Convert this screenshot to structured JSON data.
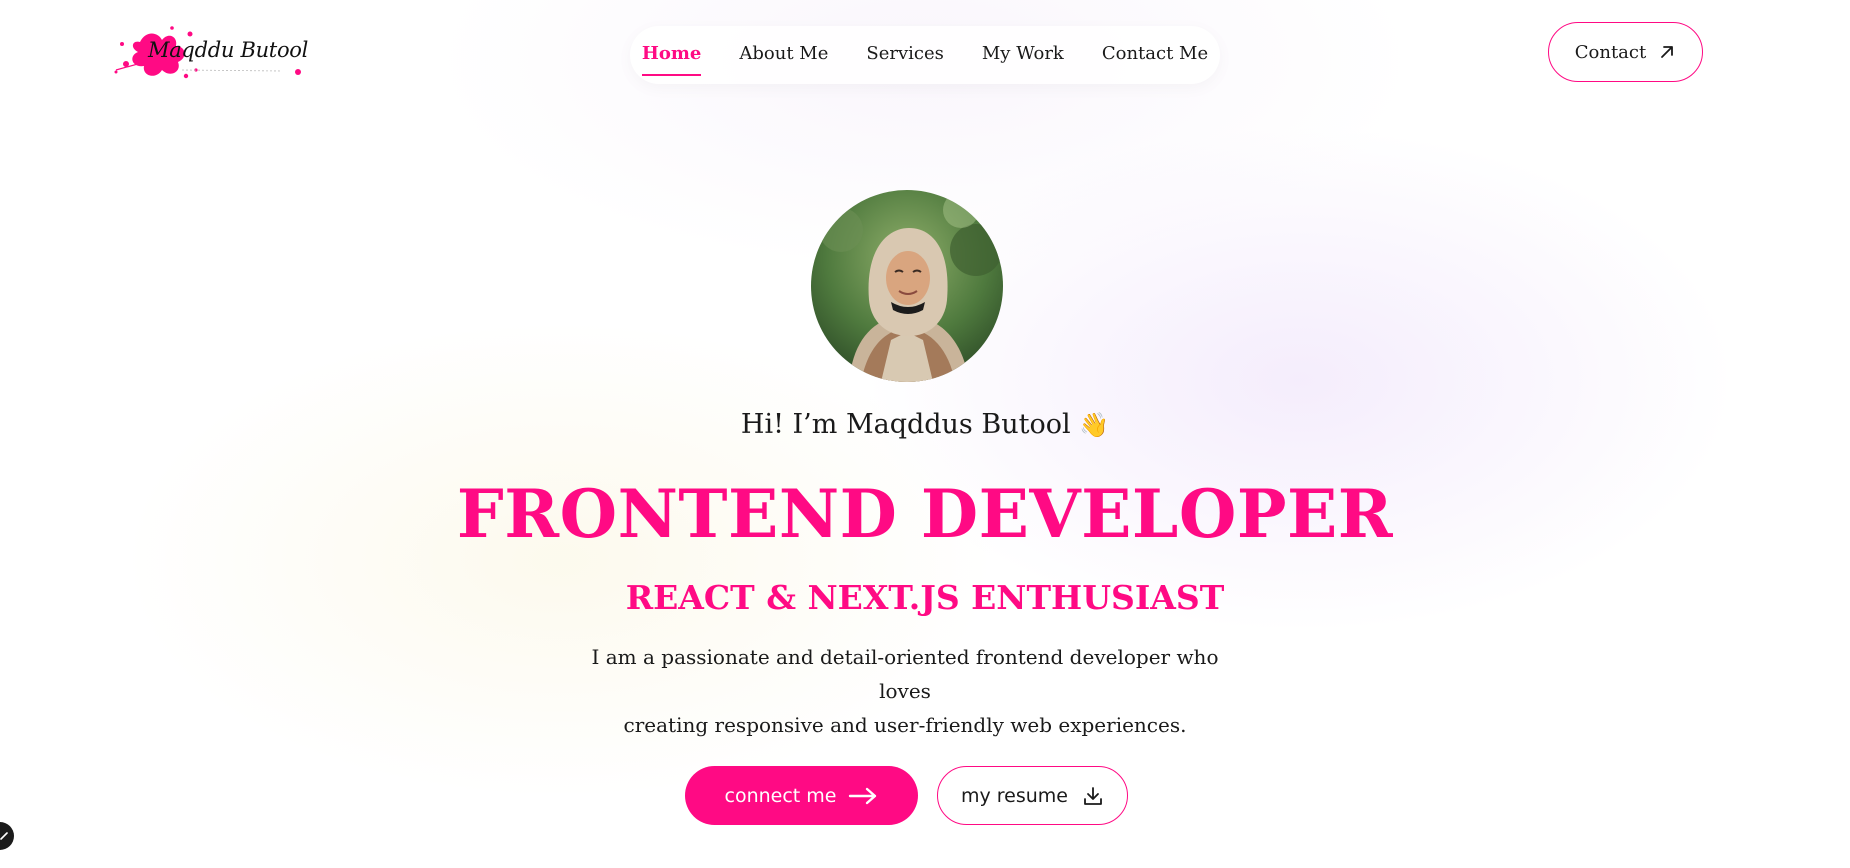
{
  "brand": {
    "logo_text": "Maqddu Butool",
    "accent_color": "#ff0a84",
    "logo_icon": "ink-splash-icon"
  },
  "nav": {
    "items": [
      {
        "label": "Home",
        "active": true
      },
      {
        "label": "About Me",
        "active": false
      },
      {
        "label": "Services",
        "active": false
      },
      {
        "label": "My Work",
        "active": false
      },
      {
        "label": "Contact Me",
        "active": false
      }
    ]
  },
  "header_cta": {
    "label": "Contact",
    "icon": "arrow-up-right-icon"
  },
  "hero": {
    "avatar_icon": "profile-photo",
    "greeting": "Hi! I’m Maqddus Butool",
    "greeting_emoji": "👋",
    "headline": "FRONTEND DEVELOPER",
    "subheadline": "REACT & NEXT.JS ENTHUSIAST",
    "bio_line1": "I am a passionate and detail-oriented frontend developer who loves",
    "bio_line2": "creating responsive and user-friendly web experiences.",
    "primary_cta": {
      "label": "connect me",
      "icon": "arrow-right-icon"
    },
    "secondary_cta": {
      "label": "my resume",
      "icon": "download-icon"
    }
  },
  "floating_widget": {
    "icon": "chevron-icon"
  }
}
